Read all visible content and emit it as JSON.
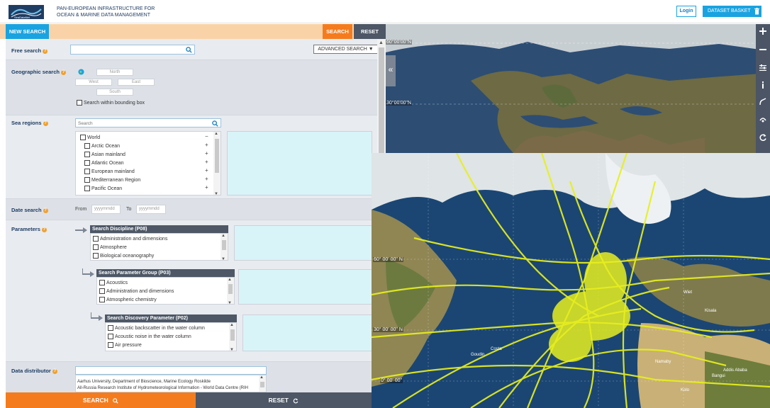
{
  "header": {
    "brand_line1": "PAN-EUROPEAN INFRASTRUCTURE FOR",
    "brand_line2": "OCEAN & MARINE DATA MANAGEMENT",
    "logo_text": "SeaDataNet",
    "login_label": "Login",
    "basket_label": "DATASET BASKET",
    "basket_count": "0"
  },
  "toolbar": {
    "new_search": "NEW SEARCH",
    "search": "SEARCH",
    "reset": "RESET"
  },
  "free_search": {
    "label": "Free search",
    "value": "",
    "advanced": "ADVANCED SEARCH ▼"
  },
  "geo": {
    "label": "Geographic search",
    "north": "North",
    "west": "West",
    "east": "East",
    "south": "South",
    "bbox_label": "Search within bounding box"
  },
  "sea_regions": {
    "label": "Sea regions",
    "search_placeholder": "Search",
    "items": [
      "World",
      "Arctic Ocean",
      "Asian mainland",
      "Atlantic Ocean",
      "European mainland",
      "Mediterranean Region",
      "Pacific Ocean"
    ]
  },
  "date": {
    "label": "Date search",
    "from": "From",
    "to": "To",
    "from_placeholder": "yyyymmdd",
    "to_placeholder": "yyyymmdd"
  },
  "parameters": {
    "label": "Parameters",
    "p08": {
      "title": "Search Discipline (P08)",
      "items": [
        "Administration and dimensions",
        "Atmosphere",
        "Biological oceanography"
      ]
    },
    "p03": {
      "title": "Search Parameter Group (P03)",
      "items": [
        "Acoustics",
        "Administration and dimensions",
        "Atmospheric chemistry"
      ]
    },
    "p02": {
      "title": "Search Discovery Parameter (P02)",
      "items": [
        "Acoustic backscatter in the water column",
        "Acoustic noise in the water column",
        "Air pressure"
      ]
    }
  },
  "distributor": {
    "label": "Data distributor",
    "items": [
      "Aarhus University, Department of Bioscience, Marine Ecology Roskilde",
      "All-Russia Research Institute of Hydrometeorological Information - World Data Centre (RIH"
    ]
  },
  "bottom": {
    "search": "SEARCH",
    "reset": "RESET"
  },
  "map": {
    "coord_top1": "60°00'00\"N",
    "coord_top2": "30°00'00\"N",
    "coord_60": "60° 00' 00\" N",
    "coord_30": "30° 00' 00\" N",
    "coord_0": "0° 00' 00\"",
    "labels": [
      "Wiet",
      "Kisala",
      "Costa",
      "Namaby",
      "Bangui",
      "Kolo",
      "Addis Ababa",
      "Goudin"
    ]
  },
  "colors": {
    "accent_blue": "#1aa3e0",
    "accent_orange": "#f47c1e",
    "dark": "#4d5766",
    "tracks": "#e7ef1f"
  }
}
